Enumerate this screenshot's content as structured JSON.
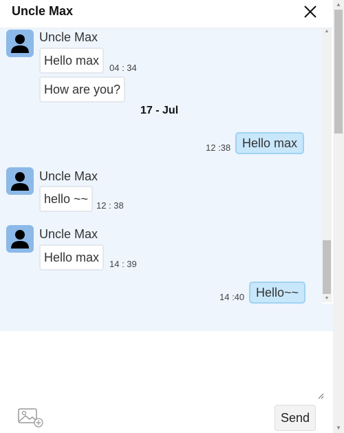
{
  "header": {
    "title": "Uncle Max",
    "close_icon": "close-icon"
  },
  "messages": [
    {
      "direction": "incoming",
      "sender": "Uncle Max",
      "bubbles": [
        {
          "text": "Hello max",
          "time": "04 : 34"
        },
        {
          "text": "How are you?",
          "time": ""
        }
      ]
    },
    {
      "type": "date_separator",
      "text": "17 - Jul"
    },
    {
      "direction": "outgoing",
      "text": "Hello max",
      "time": "12 :38"
    },
    {
      "direction": "incoming",
      "sender": "Uncle Max",
      "bubbles": [
        {
          "text": "hello ~~",
          "time": "12 : 38"
        }
      ]
    },
    {
      "direction": "incoming",
      "sender": "Uncle Max",
      "bubbles": [
        {
          "text": "Hello max",
          "time": "14 : 39"
        }
      ]
    },
    {
      "direction": "outgoing",
      "text": "Hello~~",
      "time": "14 :40"
    }
  ],
  "composer": {
    "value": "",
    "image_icon": "image-add-icon",
    "send_label": "Send"
  },
  "colors": {
    "chat_background": "#eef5fd",
    "outgoing_bubble": "#c9e7fb",
    "outgoing_border": "#9fd2f3",
    "avatar_background": "#8cb9e8"
  }
}
